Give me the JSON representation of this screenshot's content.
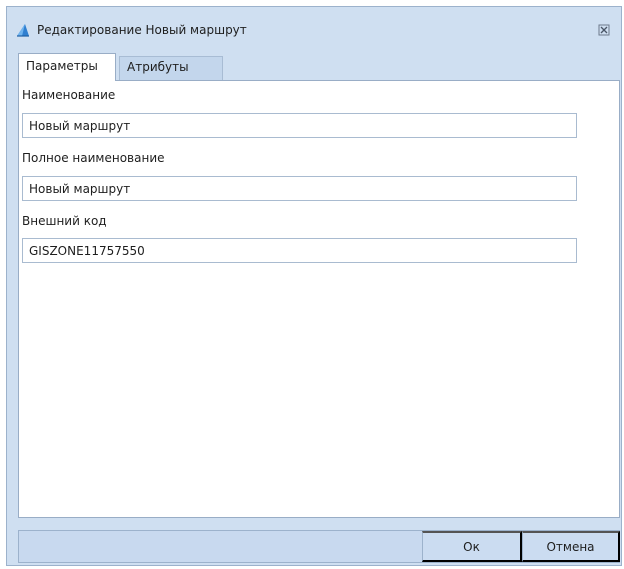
{
  "window": {
    "title": "Редактирование Новый маршрут",
    "icon": "app-triangle-icon",
    "close_icon": "close-icon"
  },
  "tabs": [
    {
      "label": "Параметры",
      "active": true
    },
    {
      "label": "Атрибуты",
      "active": false
    }
  ],
  "form": {
    "name_label": "Наименование",
    "name_value": "Новый маршрут",
    "full_name_label": "Полное наименование",
    "full_name_value": "Новый маршрут",
    "external_code_label": "Внешний код",
    "external_code_value": "GISZONE11757550"
  },
  "footer": {
    "ok_label": "Ок",
    "cancel_label": "Отмена"
  },
  "colors": {
    "frame": "#cfdff1",
    "border": "#99adc6",
    "accent": "#2f7fd0"
  }
}
